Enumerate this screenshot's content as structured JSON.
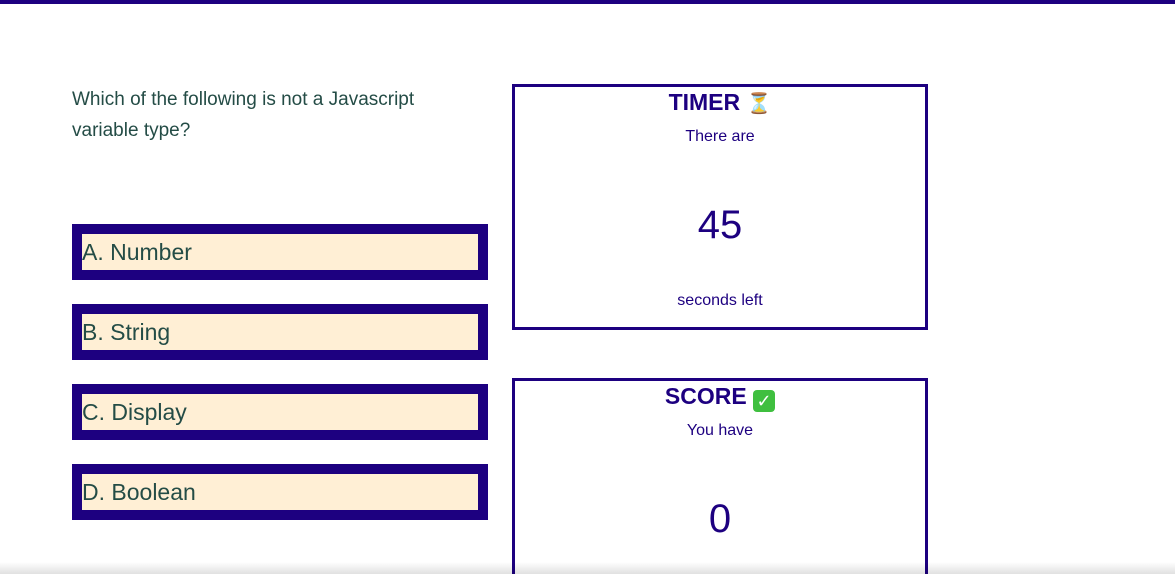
{
  "colors": {
    "accent": "#1d0080",
    "answer_fill": "#ffefd5",
    "question_text": "#244c46",
    "check_green": "#3fbf3f"
  },
  "question": {
    "text": "Which of the following is not a Javascript variable type?"
  },
  "answers": [
    {
      "label": "A. Number"
    },
    {
      "label": "B. String"
    },
    {
      "label": "C. Display"
    },
    {
      "label": "D. Boolean"
    }
  ],
  "timer": {
    "title": "TIMER",
    "icon": "hourglass-icon",
    "icon_glyph": "⏳",
    "prefix": "There are",
    "value": "45",
    "suffix": "seconds left"
  },
  "score": {
    "title": "SCORE",
    "icon": "check-icon",
    "icon_glyph": "✓",
    "prefix": "You have",
    "value": "0"
  }
}
